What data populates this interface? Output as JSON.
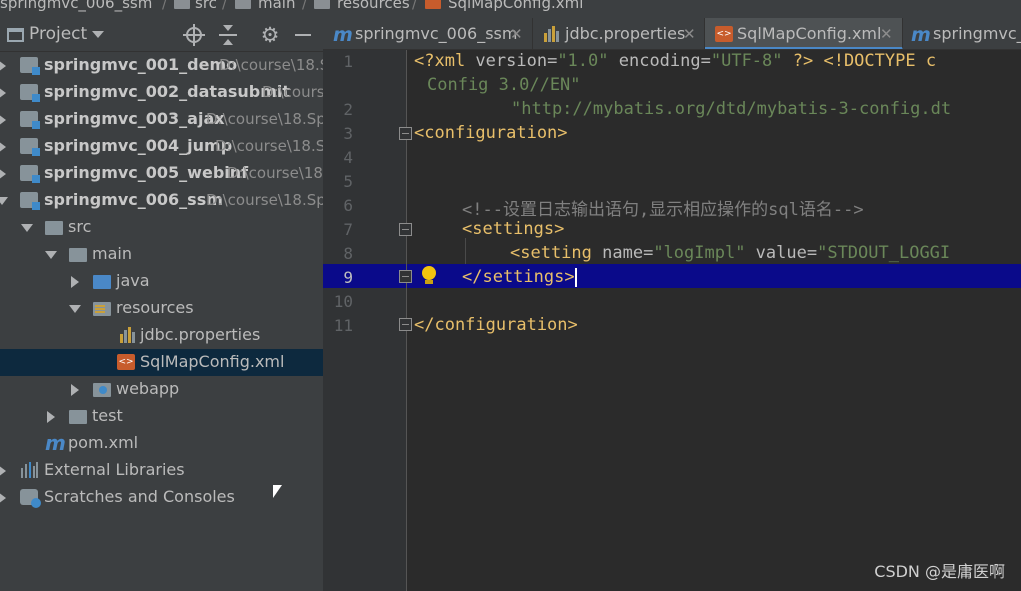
{
  "breadcrumb": [
    "springmvc_006_ssm",
    "src",
    "main",
    "resources",
    "SqlMapConfig.xml"
  ],
  "sidebar": {
    "title": "Project",
    "tree": [
      {
        "label": "springmvc_001_demo",
        "path": "D:\\course\\18.S",
        "type": "module",
        "expanded": false
      },
      {
        "label": "springmvc_002_datasubmit",
        "path": "D:\\cours",
        "type": "module",
        "expanded": false
      },
      {
        "label": "springmvc_003_ajax",
        "path": "D:\\course\\18.Sp",
        "type": "module",
        "expanded": false
      },
      {
        "label": "springmvc_004_jump",
        "path": "D:\\course\\18.S",
        "type": "module",
        "expanded": false
      },
      {
        "label": "springmvc_005_webinf",
        "path": "D:\\course\\18.",
        "type": "module",
        "expanded": false
      },
      {
        "label": "springmvc_006_ssm",
        "path": "D:\\course\\18.Sp",
        "type": "module",
        "expanded": true
      },
      {
        "label": "src",
        "type": "folder",
        "expanded": true
      },
      {
        "label": "main",
        "type": "folder",
        "expanded": true
      },
      {
        "label": "java",
        "type": "folder-blue",
        "expanded": false
      },
      {
        "label": "resources",
        "type": "folder-res",
        "expanded": true
      },
      {
        "label": "jdbc.properties",
        "type": "props"
      },
      {
        "label": "SqlMapConfig.xml",
        "type": "xml",
        "selected": true
      },
      {
        "label": "webapp",
        "type": "folder-web",
        "expanded": false
      },
      {
        "label": "test",
        "type": "folder",
        "expanded": false
      },
      {
        "label": "pom.xml",
        "type": "pom"
      },
      {
        "label": "External Libraries",
        "type": "lib",
        "expanded": false
      },
      {
        "label": "Scratches and Consoles",
        "type": "scratch",
        "expanded": false
      }
    ]
  },
  "tabs": [
    {
      "label": "springmvc_006_ssm",
      "icon": "m",
      "active": false
    },
    {
      "label": "jdbc.properties",
      "icon": "props",
      "active": false
    },
    {
      "label": "SqlMapConfig.xml",
      "icon": "xml",
      "active": true
    },
    {
      "label": "springmvc_0",
      "icon": "m",
      "active": false
    }
  ],
  "editor": {
    "line_numbers": [
      "1",
      "",
      "2",
      "3",
      "4",
      "5",
      "6",
      "7",
      "8",
      "9",
      "10",
      "11"
    ],
    "current_line": "9",
    "code": {
      "l1a": "<?xml",
      "l1b": " version=",
      "l1c": "\"1.0\"",
      "l1d": " encoding=",
      "l1e": "\"UTF-8\"",
      "l1f": " ?>",
      "l1g": " <!DOCTYPE c",
      "l1wrap": "Config 3.0//EN\"",
      "l2": "\"http://mybatis.org/dtd/mybatis-3-config.dt",
      "l3": "<configuration>",
      "l6": "<!--设置日志输出语句,显示相应操作的sql语名-->",
      "l7": "<settings>",
      "l8a": "<setting",
      "l8b": " name=",
      "l8c": "\"logImpl\"",
      "l8d": " value=",
      "l8e": "\"STDOUT_LOGGI",
      "l9": "</settings>",
      "l11": "</configuration>"
    }
  },
  "watermark": "CSDN @是庸医啊",
  "colors": {
    "selection_line": "#0a0a8a",
    "tag": "#e8bf6a",
    "string": "#6a8759",
    "comment": "#808080"
  }
}
